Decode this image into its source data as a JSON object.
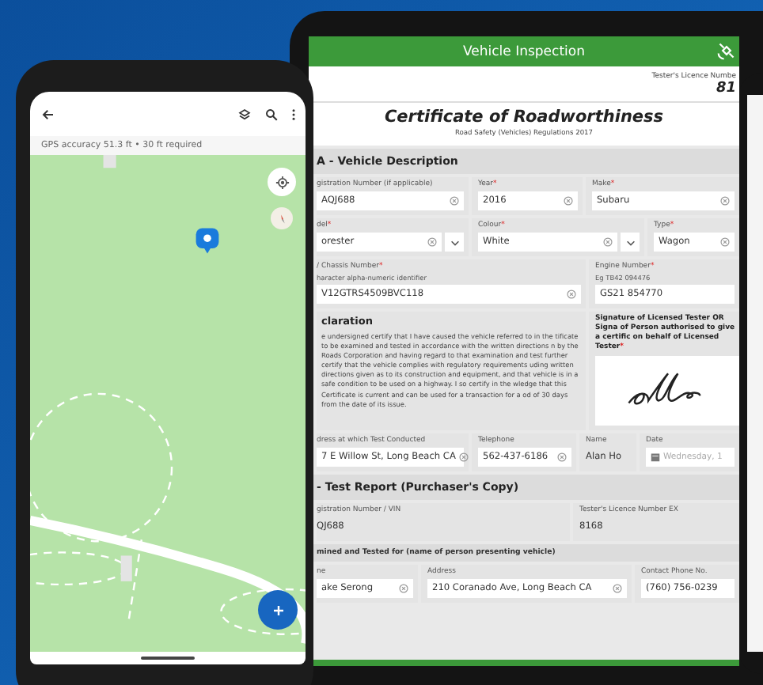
{
  "phone": {
    "gps_status": "GPS accuracy 51.3 ft • 30 ft required"
  },
  "tablet": {
    "title": "Vehicle Inspection",
    "licence_label": "Tester's Licence Numbe",
    "licence_value": "81",
    "certificate_title": "Certificate of Roadworthiness",
    "certificate_subtitle": "Road Safety (Vehicles) Regulations 2017",
    "sections": [
      {
        "heading": "A - Vehicle Description",
        "rows": [
          {
            "kind": "fields",
            "fields": [
              {
                "kind": "input",
                "label": "gistration Number (if applicable)",
                "value": "AQJ688",
                "clearable": true
              },
              {
                "kind": "input",
                "label": "Year",
                "required_mark": "*",
                "value": "2016",
                "clearable": true
              },
              {
                "kind": "input",
                "label": "Make",
                "required_mark": "*",
                "value": "Subaru",
                "clearable": true
              }
            ]
          },
          {
            "kind": "fields",
            "fields": [
              {
                "kind": "select",
                "label": "del",
                "required_mark": "*",
                "value": "orester",
                "clearable": true
              },
              {
                "kind": "select",
                "label": "Colour",
                "required_mark": "*",
                "value": "White",
                "clearable": true
              },
              {
                "kind": "input",
                "label": "Type",
                "required_mark": "*",
                "value": "Wagon",
                "clearable": true
              }
            ]
          },
          {
            "kind": "fields",
            "fields": [
              {
                "kind": "input",
                "label": "/ Chassis Number",
                "required_mark": "*",
                "hint": "haracter alpha-numeric identifier",
                "value": "V12GTRS4509BVC118",
                "clearable": true
              },
              {
                "kind": "input",
                "label": "Engine Number",
                "required_mark": "*",
                "hint": "Eg TB42 094476",
                "value": "GS21 854770",
                "clearable": false
              }
            ]
          },
          {
            "kind": "declaration",
            "title": "claration",
            "text": "e undersigned certify that I have caused the vehicle referred to in the tificate to be examined and tested in accordance with the written directions n by the Roads Corporation and having regard to that examination and test further certify that the vehicle complies with regulatory requirements uding written directions given as to its construction and equipment, and that vehicle is in a safe condition to be used on a highway. I so certify in the wledge that this Certificate is current and can be used for a transaction for a od of 30 days from the date of its issue.",
            "signature_label": "Signature of Licensed Tester OR Signa of Person authorised to give a certific on behalf of Licensed Tester",
            "required_mark": "*"
          },
          {
            "kind": "fields",
            "fields": [
              {
                "kind": "input",
                "label": "dress at which Test Conducted",
                "value": "7 E Willow St, Long Beach CA",
                "clearable": true
              },
              {
                "kind": "input",
                "label": "Telephone",
                "value": "562-437-6186",
                "clearable": true
              },
              {
                "kind": "static",
                "label": "Name",
                "value": "Alan Ho"
              },
              {
                "kind": "date",
                "label": "Date",
                "placeholder": "Wednesday, 1"
              }
            ]
          }
        ]
      },
      {
        "heading": "- Test Report (Purchaser's Copy)",
        "rows": [
          {
            "kind": "fields",
            "fields": [
              {
                "kind": "static",
                "label": "gistration Number / VIN",
                "value": "QJ688"
              },
              {
                "kind": "static",
                "label": "Tester's Licence Number EX",
                "value": "8168"
              }
            ]
          },
          {
            "kind": "subheading",
            "text": "mined and Tested for (name of person presenting vehicle)"
          },
          {
            "kind": "fields",
            "fields": [
              {
                "kind": "input",
                "label": "ne",
                "value": "ake Serong",
                "clearable": true
              },
              {
                "kind": "input",
                "label": "Address",
                "value": "210 Coranado Ave, Long Beach CA",
                "clearable": true
              },
              {
                "kind": "input",
                "label": "Contact Phone No.",
                "value": "(760) 756-0239",
                "clearable": false
              }
            ]
          }
        ]
      }
    ]
  }
}
